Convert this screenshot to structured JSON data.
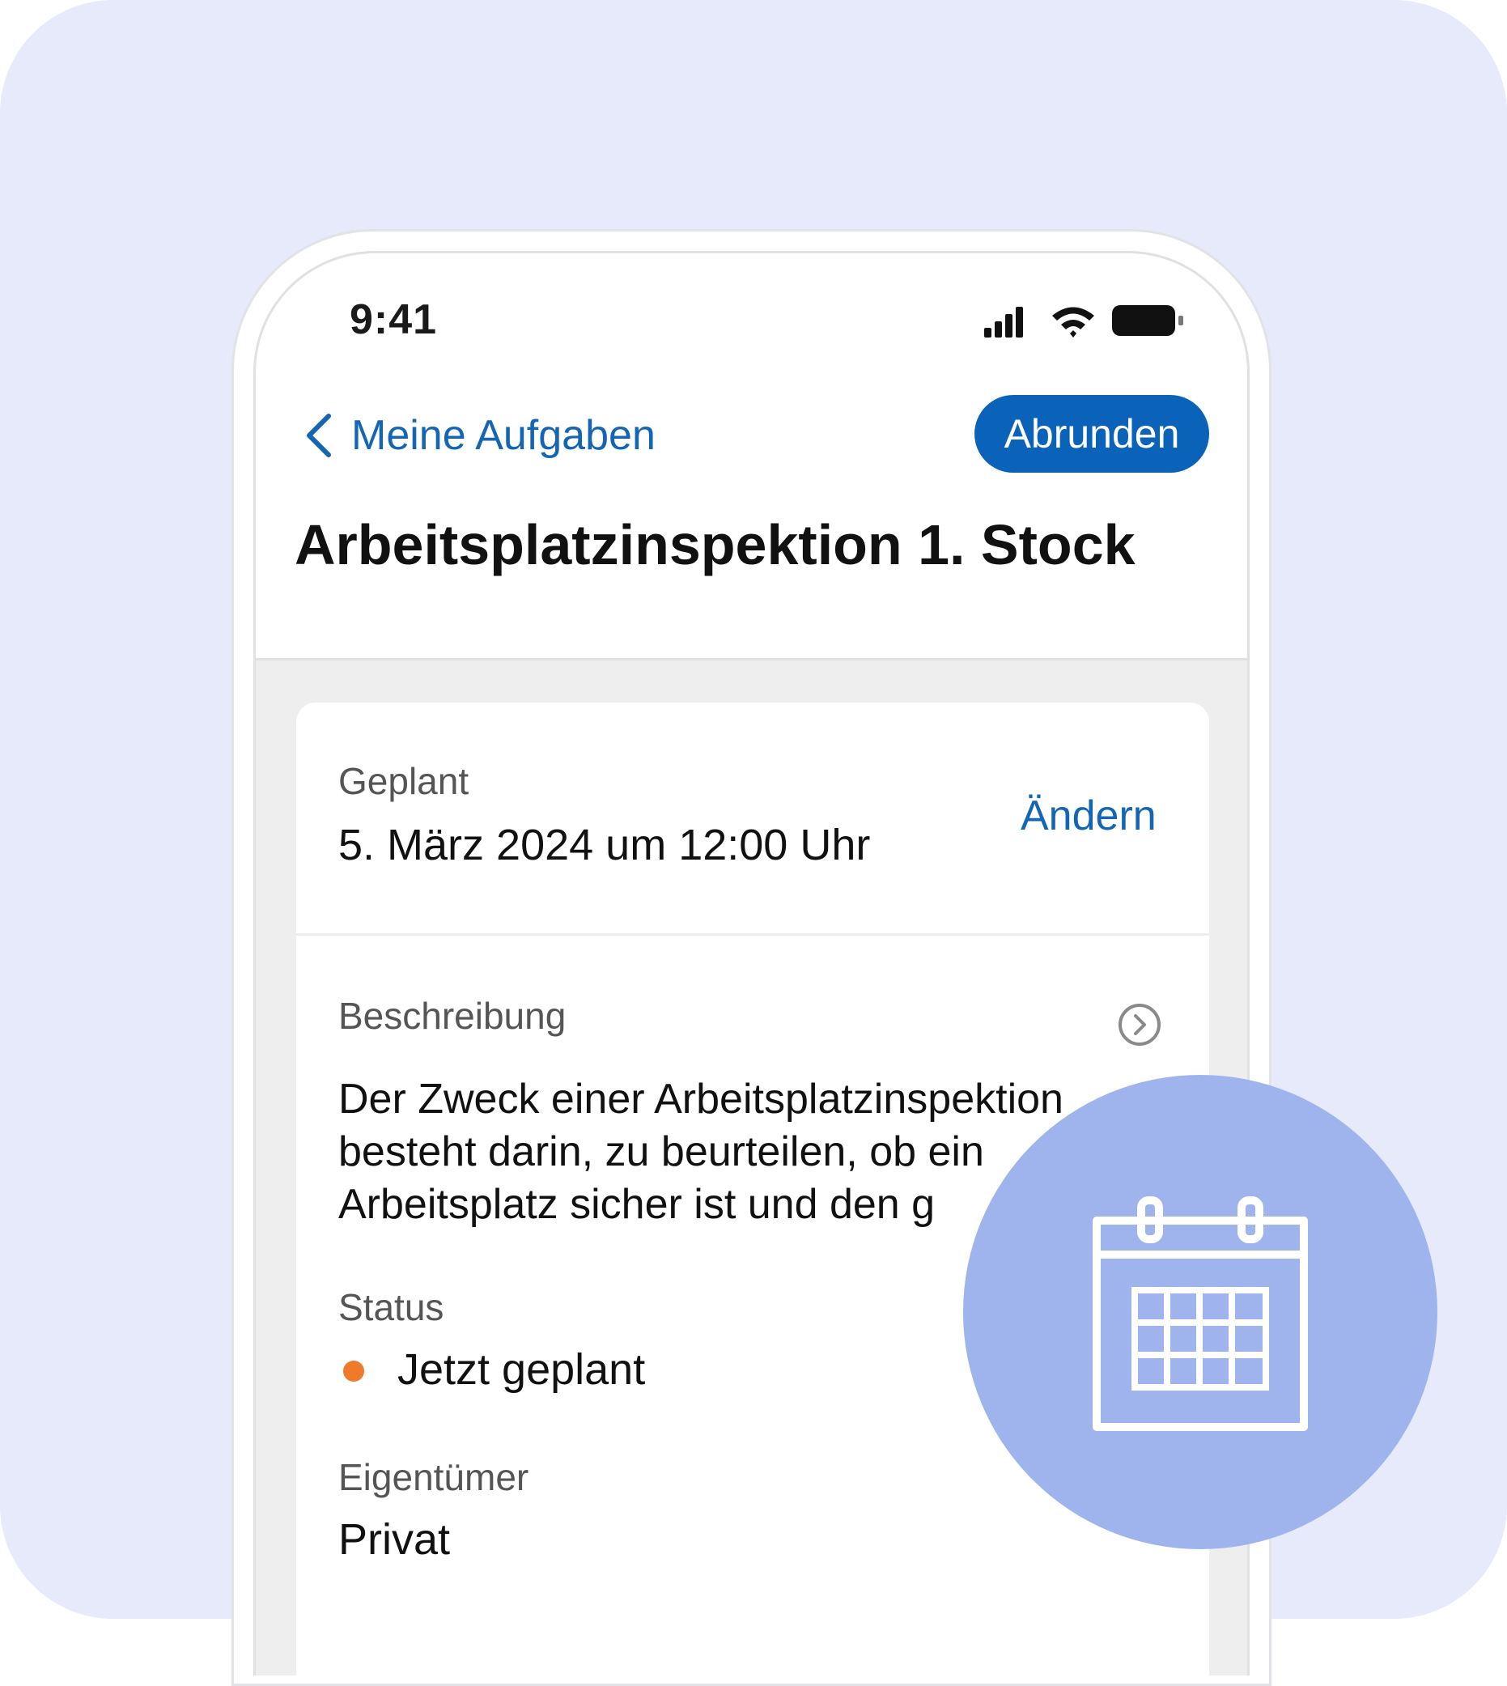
{
  "status_bar": {
    "time": "9:41"
  },
  "nav": {
    "back_label": "Meine Aufgaben",
    "primary_button": "Abrunden"
  },
  "page": {
    "title": "Arbeitsplatzinspektion 1. Stock"
  },
  "schedule": {
    "label": "Geplant",
    "value": "5. März 2024 um 12:00 Uhr",
    "change_link": "Ändern"
  },
  "description": {
    "label": "Beschreibung",
    "text": "Der Zweck einer Arbeitsplatzinspektion besteht darin, zu beurteilen, ob ein Arbeitsplatz sicher ist und den g"
  },
  "status": {
    "label": "Status",
    "value": "Jetzt geplant",
    "dot_color": "#f07a2c"
  },
  "owner": {
    "label": "Eigentümer",
    "value": "Privat"
  },
  "overlay": {
    "icon": "calendar-icon"
  },
  "colors": {
    "background": "#e6eafa",
    "accent": "#0a63b8",
    "link": "#1565b5",
    "overlay": "#9fb3ec"
  }
}
